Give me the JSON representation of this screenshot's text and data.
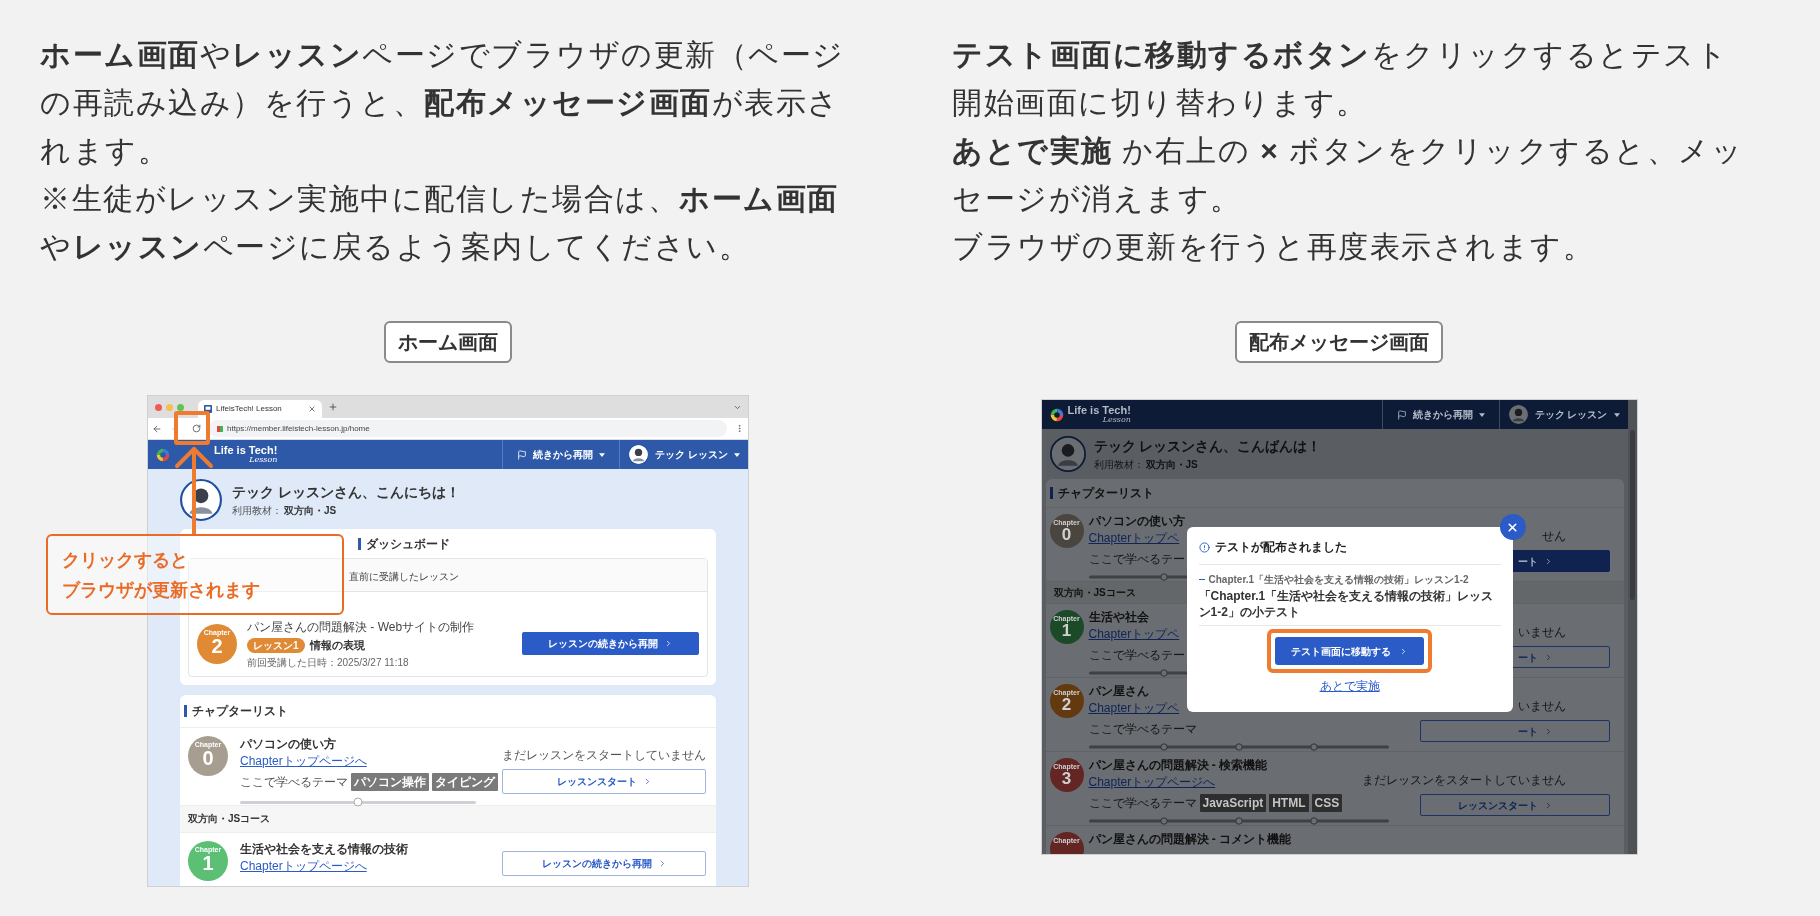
{
  "instructions": {
    "left": [
      "**ホーム画面**や**レッスン**ページでブラウザの更新（ページの再読み込み）を行うと、**配布メッセージ画面**が表示されます。",
      "※生徒がレッスン実施中に配信した場合は、**ホーム画面**や**レッスン**ページに戻るよう案内してください。"
    ],
    "right": [
      "**テスト画面に移動するボタン**をクリックするとテスト開始画面に切り替わります。",
      "**あとで実施** か右上の **×** ボタンをクリックすると、メッセージが消えます。",
      "ブラウザの更新を行うと再度表示されます。"
    ]
  },
  "home_screen": {
    "caption": "ホーム画面",
    "browser": {
      "tab_title": "LifeisTech! Lesson",
      "url": "https://member.lifeistech-lesson.jp/home"
    },
    "header": {
      "logo_title": "Life is Tech!",
      "logo_subtitle": "Lesson",
      "resume": "続きから再開",
      "user": "テック レッスン"
    },
    "greeting": {
      "title": "テック レッスンさん、こんにちは！",
      "material_label": "利用教材：",
      "material": "双方向・JS"
    },
    "dashboard": {
      "title": "ダッシュボード",
      "recent_heading": "直前に受講したレッスン",
      "chapter": {
        "color": "#e08a36",
        "caption": "Chapter",
        "number": "2"
      },
      "course": "パン屋さんの問題解決 - Webサイトの制作",
      "lesson_badge": "レッスン1",
      "lesson_title": "情報の表現",
      "last_date": "前回受講した日時：2025/3/27 11:18",
      "button": "レッスンの続きから再開"
    },
    "chapter_list": {
      "title": "チャプターリスト",
      "items": [
        {
          "kind": "chapter",
          "color": "#a79e91",
          "caption": "Chapter",
          "number": "0",
          "title": "パソコンの使い方",
          "link": "Chapterトップページへ",
          "theme_label": "ここで学べるテーマ",
          "tags": [
            "パソコン操作",
            "タイピング"
          ],
          "level": 0.5,
          "status": "まだレッスンをスタートしていません",
          "button": {
            "label": "レッスンスタート",
            "filled": false
          }
        },
        {
          "kind": "section",
          "title": "双方向・JSコース"
        },
        {
          "kind": "chapter",
          "color": "#5bbf74",
          "caption": "Chapter",
          "number": "1",
          "title": "生活や社会を支える情報の技術",
          "link": "Chapterトップページへ",
          "button": {
            "label": "レッスンの続きから再開",
            "filled": false
          }
        }
      ]
    },
    "callout": {
      "lines": [
        "クリックすると",
        "ブラウザが更新されます"
      ]
    }
  },
  "message_screen": {
    "caption": "配布メッセージ画面",
    "header": {
      "logo_title": "Life is Tech!",
      "logo_subtitle": "Lesson",
      "resume": "続きから再開",
      "user": "テック レッスン"
    },
    "greeting": {
      "title": "テック レッスンさん、こんばんは！",
      "material_label": "利用教材：",
      "material": "双方向・JS"
    },
    "chapter_list": {
      "title": "チャプターリスト",
      "items": [
        {
          "kind": "chapter",
          "color": "#4a453f",
          "caption": "Chapter",
          "number": "0",
          "title": "パソコンの使い方",
          "link": "Chapterトップペ",
          "theme_label": "ここで学べるテー",
          "status": "せん",
          "button": {
            "label": "ート",
            "filled": true
          }
        },
        {
          "kind": "section",
          "title": "双方向・JSコース"
        },
        {
          "kind": "chapter",
          "color": "#1c4a29",
          "caption": "Chapter",
          "number": "1",
          "title": "生活や社会",
          "link": "Chapterトップペ",
          "theme_label": "ここで学べるテー",
          "status": "いません",
          "button": {
            "label": "ート",
            "filled": false
          }
        },
        {
          "kind": "chapter",
          "color": "#63390f",
          "caption": "Chapter",
          "number": "2",
          "title": "パン屋さん",
          "link": "Chapterトップペ",
          "theme_label": "ここで学べるテーマ",
          "status": "いません",
          "button": {
            "label": "ート",
            "filled": false
          }
        },
        {
          "kind": "chapter",
          "color": "#632624",
          "caption": "Chapter",
          "number": "3",
          "title": "パン屋さんの問題解決 - 検索機能",
          "link": "Chapterトップページへ",
          "theme_label": "ここで学べるテーマ",
          "tags": [
            "JavaScript",
            "HTML",
            "CSS"
          ],
          "status": "まだレッスンをスタートしていません",
          "button": {
            "label": "レッスンスタート",
            "filled": false
          }
        },
        {
          "kind": "chapter",
          "color": "#632624",
          "caption": "Chapter",
          "title": "パン屋さんの問題解決 - コメント機能"
        }
      ]
    },
    "modal": {
      "title": "テストが配布されました",
      "subtitle": "Chapter.1「生活や社会を支える情報の技術」レッスン1-2",
      "heading": "「Chapter.1「生活や社会を支える情報の技術」レッスン1-2」の小テスト",
      "button": "テスト画面に移動する",
      "later_link": "あとで実施"
    }
  }
}
